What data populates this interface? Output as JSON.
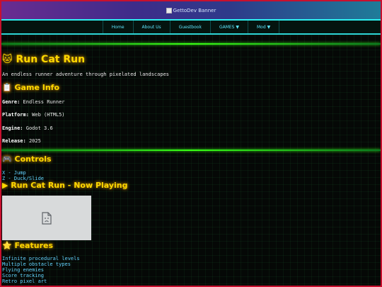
{
  "banner": {
    "alt_text": "GettoDev Banner"
  },
  "nav": {
    "items": [
      {
        "label": "Home"
      },
      {
        "label": "About Us"
      },
      {
        "label": "Guestbook"
      },
      {
        "label": "GAMES ▼"
      },
      {
        "label": "Mod ▼"
      }
    ]
  },
  "page": {
    "title": "🐱 Run Cat Run",
    "subtitle": "An endless runner adventure through pixelated landscapes"
  },
  "game_info": {
    "heading": "📋 Game Info",
    "rows": [
      {
        "label": "Genre:",
        "value": "Endless Runner"
      },
      {
        "label": "Platform:",
        "value": "Web (HTML5)"
      },
      {
        "label": "Engine:",
        "value": "Godot 3.6"
      },
      {
        "label": "Release:",
        "value": "2025"
      }
    ]
  },
  "controls": {
    "heading": "🎮 Controls",
    "items": [
      "X - Jump",
      "Z - Duck/Slide"
    ]
  },
  "now_playing": {
    "heading": "▶ Run Cat Run - Now Playing"
  },
  "features": {
    "heading": "⭐ Features",
    "items": [
      "Infinite procedural levels",
      "Multiple obstacle types",
      "Flying enemies",
      "Score tracking",
      "Retro pixel art"
    ]
  },
  "colors": {
    "accent_yellow": "#ffd800",
    "link_cyan": "#63d4ff",
    "nav_cyan": "#5ee8ff",
    "border_red": "#c8102e",
    "glow_green": "#39ff14"
  }
}
